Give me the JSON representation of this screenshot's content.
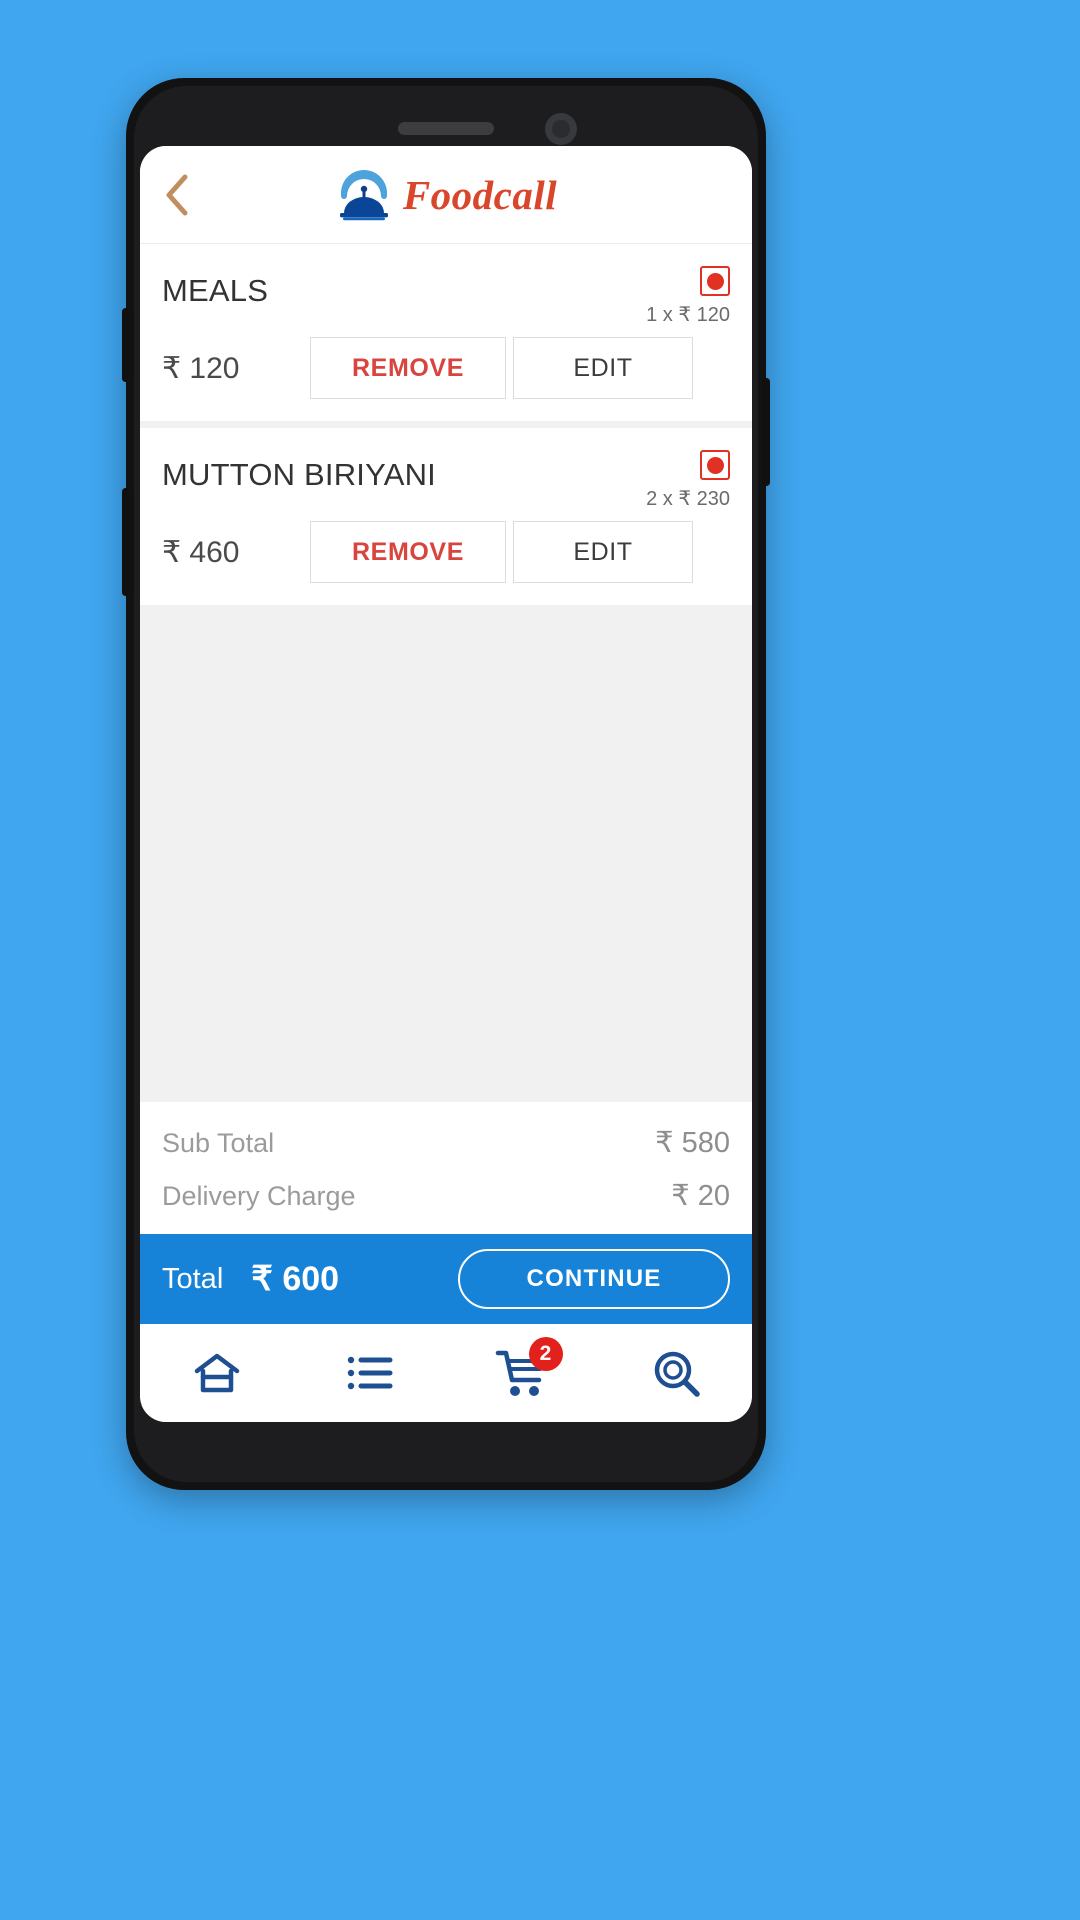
{
  "app": {
    "brand_name": "Foodcall",
    "logo_icon": "cloche-phone-logo",
    "back_icon": "chevron-left-icon",
    "accent_blue": "#1683d8",
    "accent_red": "#d9453e",
    "brand_orange": "#d8472b",
    "badge_red": "#e2211c",
    "nav_icon_blue": "#1d4f91"
  },
  "cart": {
    "items": [
      {
        "name": "MEALS",
        "diet_icon": "nonveg-indicator-icon",
        "quantity_line": "1 x ₹ 120",
        "price": "₹ 120",
        "remove_label": "REMOVE",
        "edit_label": "EDIT"
      },
      {
        "name": "MUTTON BIRIYANI",
        "diet_icon": "nonveg-indicator-icon",
        "quantity_line": "2 x ₹ 230",
        "price": "₹ 460",
        "remove_label": "REMOVE",
        "edit_label": "EDIT"
      }
    ]
  },
  "summary": {
    "sub_total_label": "Sub Total",
    "sub_total_value": "₹ 580",
    "delivery_label": "Delivery Charge",
    "delivery_value": "₹ 20"
  },
  "total_bar": {
    "total_label": "Total",
    "total_value": "₹ 600",
    "continue_label": "CONTINUE"
  },
  "bottom_nav": {
    "items": [
      {
        "icon": "home-icon",
        "name": "home"
      },
      {
        "icon": "list-icon",
        "name": "orders"
      },
      {
        "icon": "cart-icon",
        "name": "cart",
        "badge": "2"
      },
      {
        "icon": "search-icon",
        "name": "search"
      }
    ]
  }
}
